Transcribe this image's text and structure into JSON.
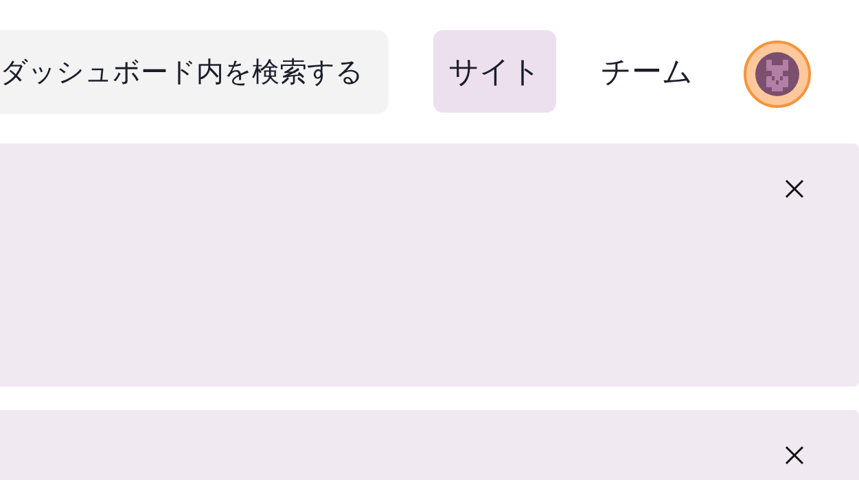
{
  "search": {
    "placeholder": "ダッシュボード内を検索する"
  },
  "tabs": [
    {
      "label": "サイト",
      "selected": true
    },
    {
      "label": "チーム",
      "selected": false
    }
  ],
  "panels": [
    {
      "dismissible": true
    },
    {
      "dismissible": true
    }
  ]
}
